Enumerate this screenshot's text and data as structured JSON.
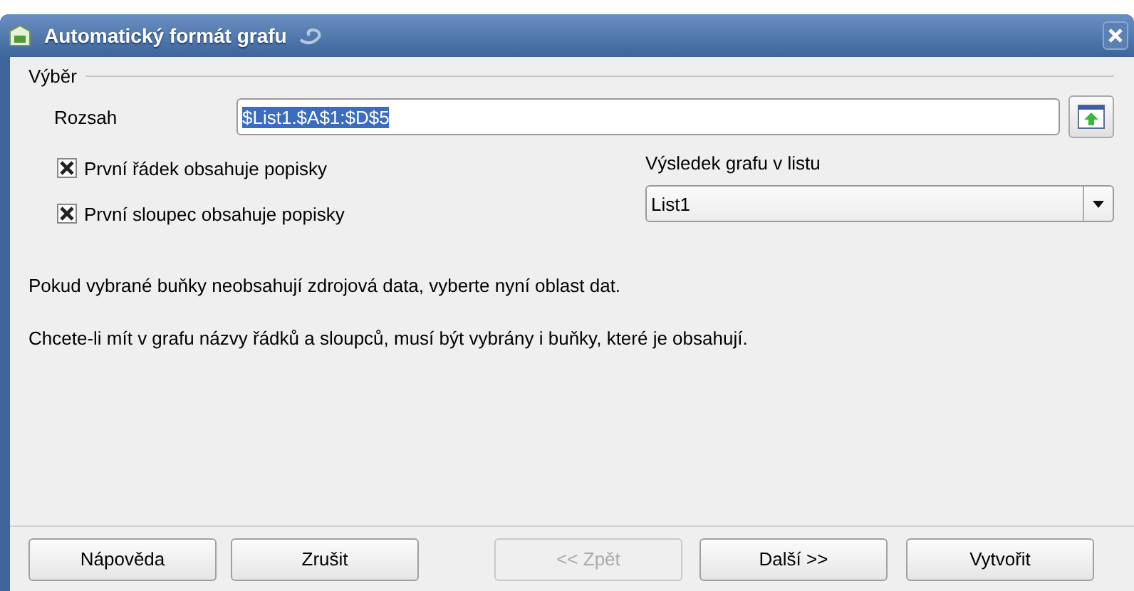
{
  "window": {
    "title": "Automatický formát grafu"
  },
  "selection": {
    "legend": "Výběr",
    "range_label": "Rozsah",
    "range_value": "$List1.$A$1:$D$5"
  },
  "checkboxes": [
    {
      "label": "První řádek obsahuje popisky",
      "checked": true
    },
    {
      "label": "První sloupec obsahuje popisky",
      "checked": true
    }
  ],
  "target": {
    "label": "Výsledek grafu v listu",
    "value": "List1"
  },
  "messages": [
    "Pokud vybrané buňky neobsahují zdrojová data, vyberte nyní oblast dat.",
    "Chcete-li mít v grafu názvy řádků a sloupců, musí být vybrány i buňky, které je obsahují."
  ],
  "buttons": [
    {
      "label": "Nápověda",
      "disabled": false
    },
    {
      "label": "Zrušit",
      "disabled": false
    },
    {
      "label": "<< Zpět",
      "disabled": true
    },
    {
      "label": "Další >>",
      "disabled": false
    },
    {
      "label": "Vytvořit",
      "disabled": false
    }
  ]
}
